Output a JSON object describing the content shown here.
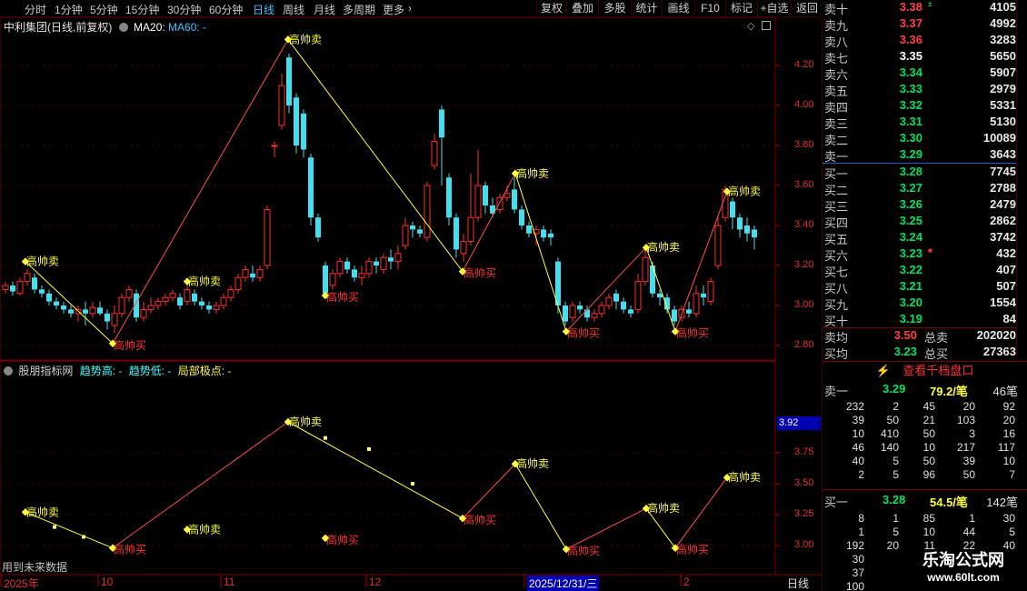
{
  "toolbar": {
    "periods": [
      "分时",
      "1分钟",
      "5分钟",
      "15分钟",
      "30分钟",
      "60分钟",
      "日线",
      "周线",
      "月线",
      "多周期",
      "更多"
    ],
    "active": "日线",
    "buttons": [
      "复权",
      "叠加",
      "多股",
      "统计",
      "画线",
      "F10",
      "标记",
      "+自选",
      "返回"
    ]
  },
  "main_title": {
    "stock": "中利集团(日线,前复权)",
    "ma20": "MA20: ",
    "ma60": "MA60: -"
  },
  "ind_title": {
    "name": "股朋指标网",
    "up": "趋势高: -",
    "down": "趋势低: -",
    "pivot": "局部极点: -"
  },
  "axis_main": [
    "4.20",
    "4.00",
    "3.80",
    "3.60",
    "3.40",
    "3.20",
    "3.00",
    "2.80"
  ],
  "axis_ind": [
    "3.75",
    "3.50",
    "3.25",
    "3.00"
  ],
  "axis_ind_current": "3.92",
  "x_labels": [
    "2025年",
    "10",
    "11",
    "12",
    "2025/12/31/三",
    "2"
  ],
  "bottom_right_label": "日线",
  "future_note": "用到未来数据",
  "sell_label": "高帅卖",
  "buy_label": "高帅买",
  "order_book": {
    "asks": [
      {
        "label": "卖十",
        "price": "3.38",
        "vol": "4105",
        "color": "red",
        "mark": "±"
      },
      {
        "label": "卖九",
        "price": "3.37",
        "vol": "4992",
        "color": "red"
      },
      {
        "label": "卖八",
        "price": "3.36",
        "vol": "3283",
        "color": "red"
      },
      {
        "label": "卖七",
        "price": "3.35",
        "vol": "5650",
        "color": "wht"
      },
      {
        "label": "卖六",
        "price": "3.34",
        "vol": "5907",
        "color": "green"
      },
      {
        "label": "卖五",
        "price": "3.33",
        "vol": "2979",
        "color": "green"
      },
      {
        "label": "卖四",
        "price": "3.32",
        "vol": "5331",
        "color": "green"
      },
      {
        "label": "卖三",
        "price": "3.31",
        "vol": "5130",
        "color": "green"
      },
      {
        "label": "卖二",
        "price": "3.30",
        "vol": "10089",
        "color": "green"
      },
      {
        "label": "卖一",
        "price": "3.29",
        "vol": "3643",
        "color": "green"
      }
    ],
    "bids": [
      {
        "label": "买一",
        "price": "3.28",
        "vol": "7745",
        "color": "green"
      },
      {
        "label": "买二",
        "price": "3.27",
        "vol": "2788",
        "color": "green"
      },
      {
        "label": "买三",
        "price": "3.26",
        "vol": "2479",
        "color": "green"
      },
      {
        "label": "买四",
        "price": "3.25",
        "vol": "2862",
        "color": "green"
      },
      {
        "label": "买五",
        "price": "3.24",
        "vol": "3742",
        "color": "green"
      },
      {
        "label": "买六",
        "price": "3.23",
        "vol": "432",
        "color": "green",
        "mark": "■"
      },
      {
        "label": "买七",
        "price": "3.22",
        "vol": "407",
        "color": "green"
      },
      {
        "label": "买八",
        "price": "3.21",
        "vol": "507",
        "color": "green"
      },
      {
        "label": "买九",
        "price": "3.20",
        "vol": "1554",
        "color": "green"
      },
      {
        "label": "买十",
        "price": "3.19",
        "vol": "84",
        "color": "green"
      }
    ],
    "avg_sell": {
      "label": "卖均",
      "price": "3.50",
      "tlabel": "总卖",
      "total": "202020"
    },
    "avg_buy": {
      "label": "买均",
      "price": "3.23",
      "tlabel": "总买",
      "total": "27363"
    }
  },
  "qiandang_button": "查看千档盘口",
  "ask1": {
    "label": "卖一",
    "price": "3.29",
    "avg": "79.2/笔",
    "count": "46笔"
  },
  "ask1_grid": [
    [
      "232",
      "2",
      "45",
      "20",
      "92"
    ],
    [
      "39",
      "50",
      "21",
      "103",
      "20"
    ],
    [
      "10",
      "410",
      "50",
      "3",
      "16"
    ],
    [
      "46",
      "140",
      "10",
      "217",
      "117"
    ],
    [
      "40",
      "5",
      "50",
      "39",
      "10"
    ],
    [
      "2",
      "5",
      "96",
      "50",
      "7"
    ]
  ],
  "bid1": {
    "label": "买一",
    "price": "3.28",
    "avg": "54.5/笔",
    "count": "142笔"
  },
  "bid1_grid": [
    [
      "8",
      "1",
      "85",
      "1",
      "30"
    ],
    [
      "1",
      "5",
      "10",
      "44",
      "5"
    ],
    [
      "192",
      "20",
      "11",
      "22",
      "40"
    ],
    [
      "30",
      "",
      "",
      "",
      ""
    ],
    [
      "37",
      "",
      "",
      "",
      ""
    ],
    [
      "100",
      "",
      "",
      "",
      ""
    ]
  ],
  "watermark": {
    "title": "乐淘公式网",
    "url": "www.60lt.com"
  },
  "colors": {
    "up": "#ff3030",
    "down": "#40e0f0",
    "sell": "#ffff40",
    "buy": "#ff3030",
    "grid": "#5a0000"
  }
}
